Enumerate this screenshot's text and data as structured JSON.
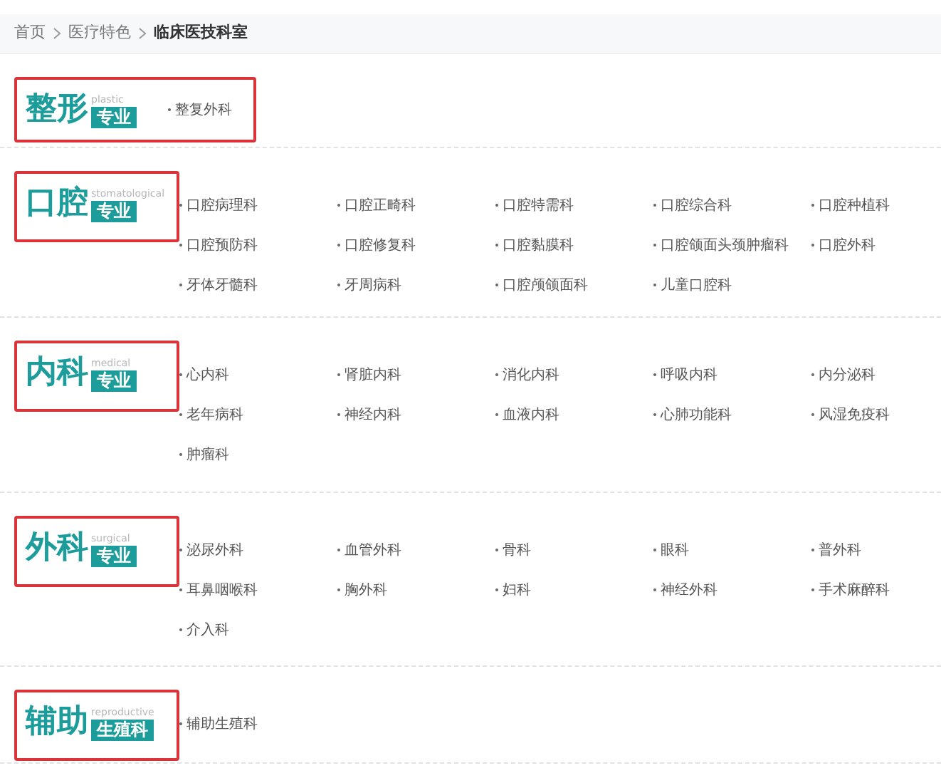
{
  "breadcrumb": [
    {
      "label": "首页",
      "current": false
    },
    {
      "label": "医疗特色",
      "current": false
    },
    {
      "label": "临床医技科室",
      "current": true
    }
  ],
  "sections": [
    {
      "title": "整形",
      "english": "plastic",
      "tag": "专业",
      "wraps_items": true,
      "items": [
        "整复外科"
      ]
    },
    {
      "title": "口腔",
      "english": "stomatological",
      "tag": "专业",
      "wraps_items": false,
      "items": [
        "口腔病理科",
        "口腔正畸科",
        "口腔特需科",
        "口腔综合科",
        "口腔种植科",
        "口腔预防科",
        "口腔修复科",
        "口腔黏膜科",
        "口腔颌面头颈肿瘤科",
        "口腔外科",
        "牙体牙髓科",
        "牙周病科",
        "口腔颅颌面科",
        "儿童口腔科"
      ]
    },
    {
      "title": "内科",
      "english": "medical",
      "tag": "专业",
      "wraps_items": false,
      "items": [
        "心内科",
        "肾脏内科",
        "消化内科",
        "呼吸内科",
        "内分泌科",
        "老年病科",
        "神经内科",
        "血液内科",
        "心肺功能科",
        "风湿免疫科",
        "肿瘤科"
      ]
    },
    {
      "title": "外科",
      "english": "surgical",
      "tag": "专业",
      "wraps_items": false,
      "items": [
        "泌尿外科",
        "血管外科",
        "骨科",
        "眼科",
        "普外科",
        "耳鼻咽喉科",
        "胸外科",
        "妇科",
        "神经外科",
        "手术麻醉科",
        "介入科"
      ]
    },
    {
      "title": "辅助",
      "english": "reproductive",
      "tag": "生殖科",
      "wraps_items": false,
      "items": [
        "辅助生殖科"
      ]
    }
  ]
}
